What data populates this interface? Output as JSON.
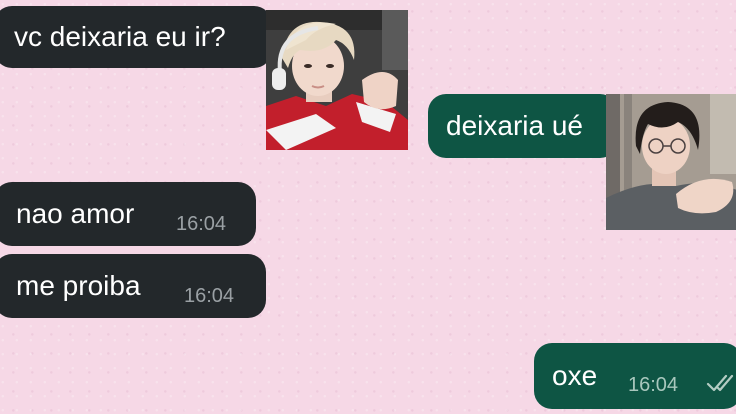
{
  "messages": [
    {
      "id": "m1",
      "direction": "incoming",
      "text": "vc deixaria eu ir?"
    },
    {
      "id": "m2",
      "direction": "outgoing",
      "text": "deixaria ué"
    },
    {
      "id": "m3",
      "direction": "incoming",
      "text": "nao amor",
      "time": "16:04"
    },
    {
      "id": "m4",
      "direction": "incoming",
      "text": "me proiba",
      "time": "16:04"
    },
    {
      "id": "m5",
      "direction": "outgoing",
      "text": "oxe",
      "time": "16:04",
      "status_icon": "double-check-icon"
    }
  ],
  "stickers": [
    {
      "id": "s1",
      "icon": "photo-sticker-blond-boy"
    },
    {
      "id": "s2",
      "icon": "photo-sticker-dark-haired-boy"
    }
  ],
  "colors": {
    "wallpaper": "#f6d8e6",
    "incoming_bubble": "#23282b",
    "outgoing_bubble": "#0e5544",
    "text": "#ffffff",
    "time_incoming": "#9aa0a4",
    "time_outgoing": "#a8c7bd"
  }
}
